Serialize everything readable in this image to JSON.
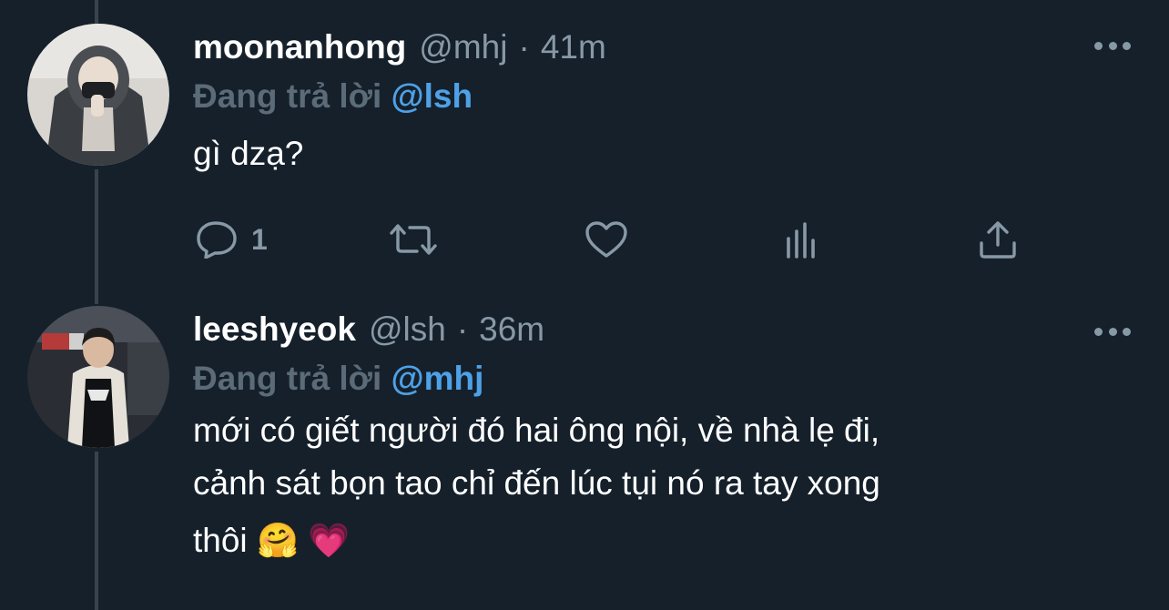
{
  "tweets": [
    {
      "display_name": "moonanhong",
      "handle": "@mhj",
      "separator": "·",
      "time": "41m",
      "reply_prefix": "Đang trả lời",
      "reply_to": "@lsh",
      "text": "gì dzạ?",
      "actions": {
        "reply_count": "1",
        "retweet_count": "",
        "like_count": ""
      }
    },
    {
      "display_name": "leeshyeok",
      "handle": "@lsh",
      "separator": "·",
      "time": "36m",
      "reply_prefix": "Đang trả lời",
      "reply_to": "@mhj",
      "text_lines": [
        "mới có giết người đó hai ông nội, về nhà lẹ đi,",
        "cảnh sát bọn tao chỉ đến lúc tụi nó ra tay xong",
        "thôi"
      ],
      "emojis": [
        "🤗",
        "💗"
      ]
    }
  ],
  "colors": {
    "background": "#15202b",
    "primary_text": "#ffffff",
    "secondary_text": "#8899a6",
    "mention": "#1d9bf0",
    "thread_line": "#38444d"
  },
  "icons": [
    "reply-icon",
    "retweet-icon",
    "like-icon",
    "analytics-icon",
    "share-icon",
    "more-icon"
  ]
}
